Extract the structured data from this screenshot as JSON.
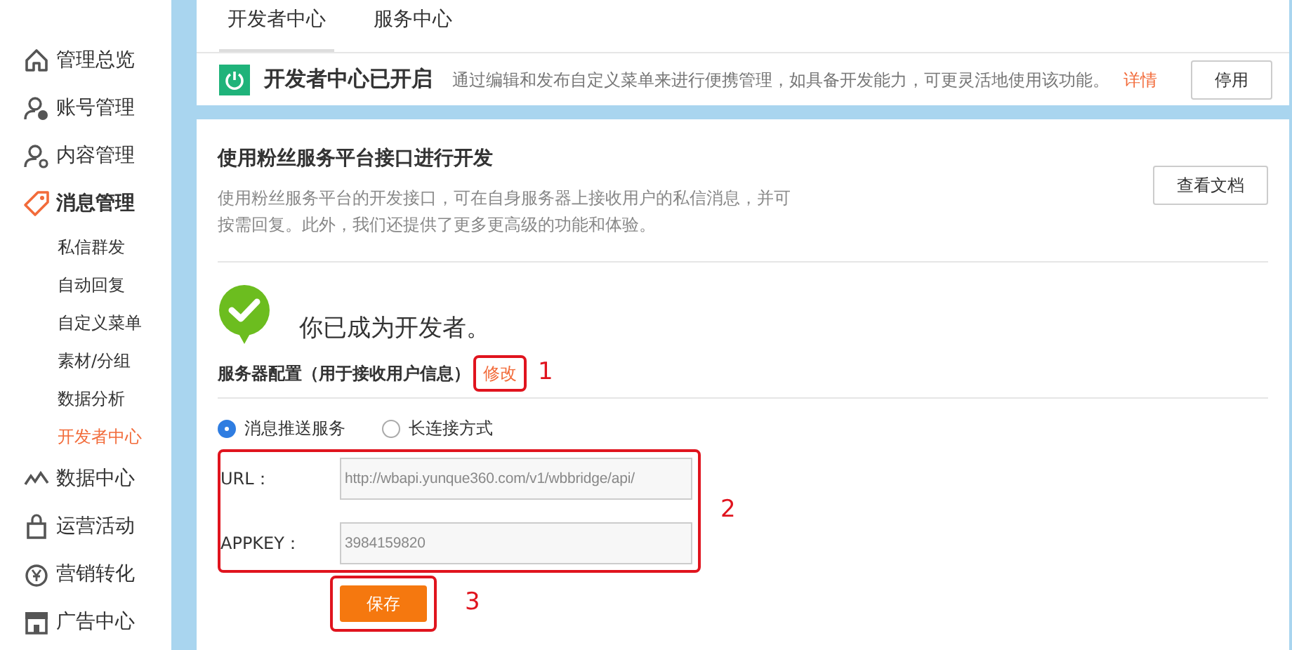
{
  "sidebar": {
    "items": [
      {
        "label": "管理总览",
        "selected": false
      },
      {
        "label": "账号管理",
        "selected": false
      },
      {
        "label": "内容管理",
        "selected": false
      },
      {
        "label": "消息管理",
        "selected": true,
        "children": [
          {
            "label": "私信群发",
            "selected": false
          },
          {
            "label": "自动回复",
            "selected": false
          },
          {
            "label": "自定义菜单",
            "selected": false
          },
          {
            "label": "素材/分组",
            "selected": false
          },
          {
            "label": "数据分析",
            "selected": false
          },
          {
            "label": "开发者中心",
            "selected": true
          }
        ]
      },
      {
        "label": "数据中心",
        "selected": false
      },
      {
        "label": "运营活动",
        "selected": false
      },
      {
        "label": "营销转化",
        "selected": false
      },
      {
        "label": "广告中心",
        "selected": false
      }
    ]
  },
  "tabs": [
    {
      "label": "开发者中心",
      "selected": true
    },
    {
      "label": "服务中心",
      "selected": false
    }
  ],
  "status": {
    "on": true,
    "title": "开发者中心已开启",
    "text": "通过编辑和发布自定义菜单来进行便携管理，如具备开发能力，可更灵活地使用该功能。",
    "link": "详情",
    "button": "停用"
  },
  "intro": {
    "title": "使用粉丝服务平台接口进行开发",
    "text": "使用粉丝服务平台的开发接口，可在自身服务器上接收用户的私信消息，并可按需回复。此外，我们还提供了更多更高级的功能和体验。",
    "button": "查看文档"
  },
  "result": "你已成为开发者。",
  "server_config": {
    "label": "服务器配置（用于接收用户信息）",
    "edit_link": "修改",
    "annotation": "1"
  },
  "modes": [
    {
      "label": "消息推送服务",
      "selected": true
    },
    {
      "label": "长连接方式",
      "selected": false
    }
  ],
  "fields": {
    "annotation": "2",
    "items": [
      {
        "label": "URL：",
        "value": "http://wbapi.yunque360.com/v1/wbbridge/api/"
      },
      {
        "label": "APPKEY：",
        "value": "3984159820"
      }
    ]
  },
  "save": {
    "button": "保存",
    "annotation": "3"
  }
}
